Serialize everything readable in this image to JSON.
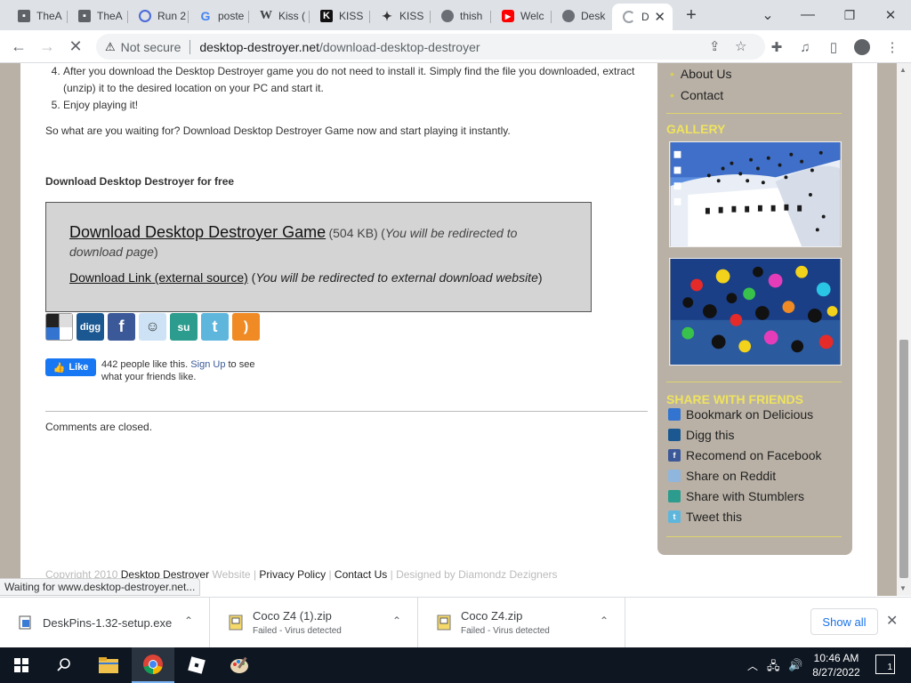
{
  "tabs": [
    {
      "title": "TheA",
      "icon": "book-icon"
    },
    {
      "title": "TheA",
      "icon": "book-icon"
    },
    {
      "title": "Run 2",
      "icon": "run-icon"
    },
    {
      "title": "poste",
      "icon": "google-icon"
    },
    {
      "title": "Kiss (",
      "icon": "wikipedia-icon"
    },
    {
      "title": "KISS",
      "icon": "kiss-icon"
    },
    {
      "title": "KISS",
      "icon": "star-icon"
    },
    {
      "title": "thish",
      "icon": "globe-icon"
    },
    {
      "title": "Welc",
      "icon": "youtube-icon"
    },
    {
      "title": "Desk",
      "icon": "globe-icon"
    },
    {
      "title": "D",
      "icon": "loading-icon"
    }
  ],
  "window_controls": {
    "minimize": "—",
    "restore": "❐",
    "close": "✕",
    "new_tab": "+",
    "tab_search": "⌄"
  },
  "address": {
    "security_label": "Not secure",
    "host": "desktop-destroyer.net",
    "path": "/download-desktop-destroyer"
  },
  "page": {
    "list_items": [
      "After you download the Desktop Destroyer game you do not need to install it. Simply find the file you downloaded, extract (unzip) it to the desired location on your PC and start it.",
      "Enjoy playing it!"
    ],
    "list_start": 4,
    "cta_text": "So what are you waiting for? Download Desktop Destroyer Game now and start playing it instantly.",
    "download_heading": "Download Desktop Destroyer for free",
    "download_link": "Download Desktop Destroyer Game",
    "download_size": "(504 KB)",
    "download_note_open": "(",
    "download_note": "You will be redirected to download page",
    "download_note_close": ")",
    "external_link": "Download Link (external source)",
    "external_note": "You will be redirected to external download website",
    "social_icons": [
      "delicious-icon",
      "digg-icon",
      "facebook-icon",
      "reddit-icon",
      "stumbleupon-icon",
      "twitter-icon",
      "rss-icon"
    ],
    "social_labels": {
      "digg": "digg",
      "facebook": "f",
      "reddit": "☺",
      "stumbleupon": "su",
      "twitter": "t",
      "rss": ")"
    },
    "like_button": "Like",
    "like_count_text": "442 people like this.",
    "like_signup": "Sign Up",
    "like_suffix": "to see what your friends like.",
    "comments_closed": "Comments are closed.",
    "footer": {
      "copyright": "Copyright 2010",
      "site_name": "Desktop Destroyer",
      "website": "Website",
      "sep1": "|",
      "privacy": "Privacy Policy",
      "sep2": "|",
      "contact": "Contact Us",
      "sep3": "|",
      "designed_by": "Designed by Diamondz Dezigners"
    }
  },
  "sidebar": {
    "nav": [
      "About Us",
      "Contact"
    ],
    "gallery_title": "GALLERY",
    "share_title": "SHARE WITH FRIENDS",
    "share_items": [
      {
        "label": "Bookmark on Delicious",
        "icon": "delicious-icon",
        "color": "#3274d0"
      },
      {
        "label": "Digg this",
        "icon": "digg-icon",
        "color": "#1b5891"
      },
      {
        "label": "Recomend on Facebook",
        "icon": "facebook-icon",
        "color": "#3b5998"
      },
      {
        "label": "Share on Reddit",
        "icon": "reddit-icon",
        "color": "#8fb6dc"
      },
      {
        "label": "Share with Stumblers",
        "icon": "stumbleupon-icon",
        "color": "#2b9c8d"
      },
      {
        "label": "Tweet this",
        "icon": "twitter-icon",
        "color": "#5fb6dd"
      }
    ]
  },
  "status_bar": "Waiting for www.desktop-destroyer.net...",
  "downloads": [
    {
      "name": "DeskPins-1.32-setup.exe",
      "status": ""
    },
    {
      "name": "Coco Z4 (1).zip",
      "status": "Failed - Virus detected"
    },
    {
      "name": "Coco Z4.zip",
      "status": "Failed - Virus detected"
    }
  ],
  "show_all": "Show all",
  "taskbar": {
    "time": "10:46 AM",
    "date": "8/27/2022",
    "notification_count": "1",
    "apps": [
      "file-explorer-icon",
      "chrome-icon",
      "roblox-icon",
      "paint-icon"
    ]
  },
  "colors": {
    "sidebar_bg": "#b9b1a6",
    "sidebar_heading": "#efe35e",
    "download_box": "#d5d4d4",
    "link_blue": "#1a73e8",
    "taskbar": "#0e1621"
  }
}
